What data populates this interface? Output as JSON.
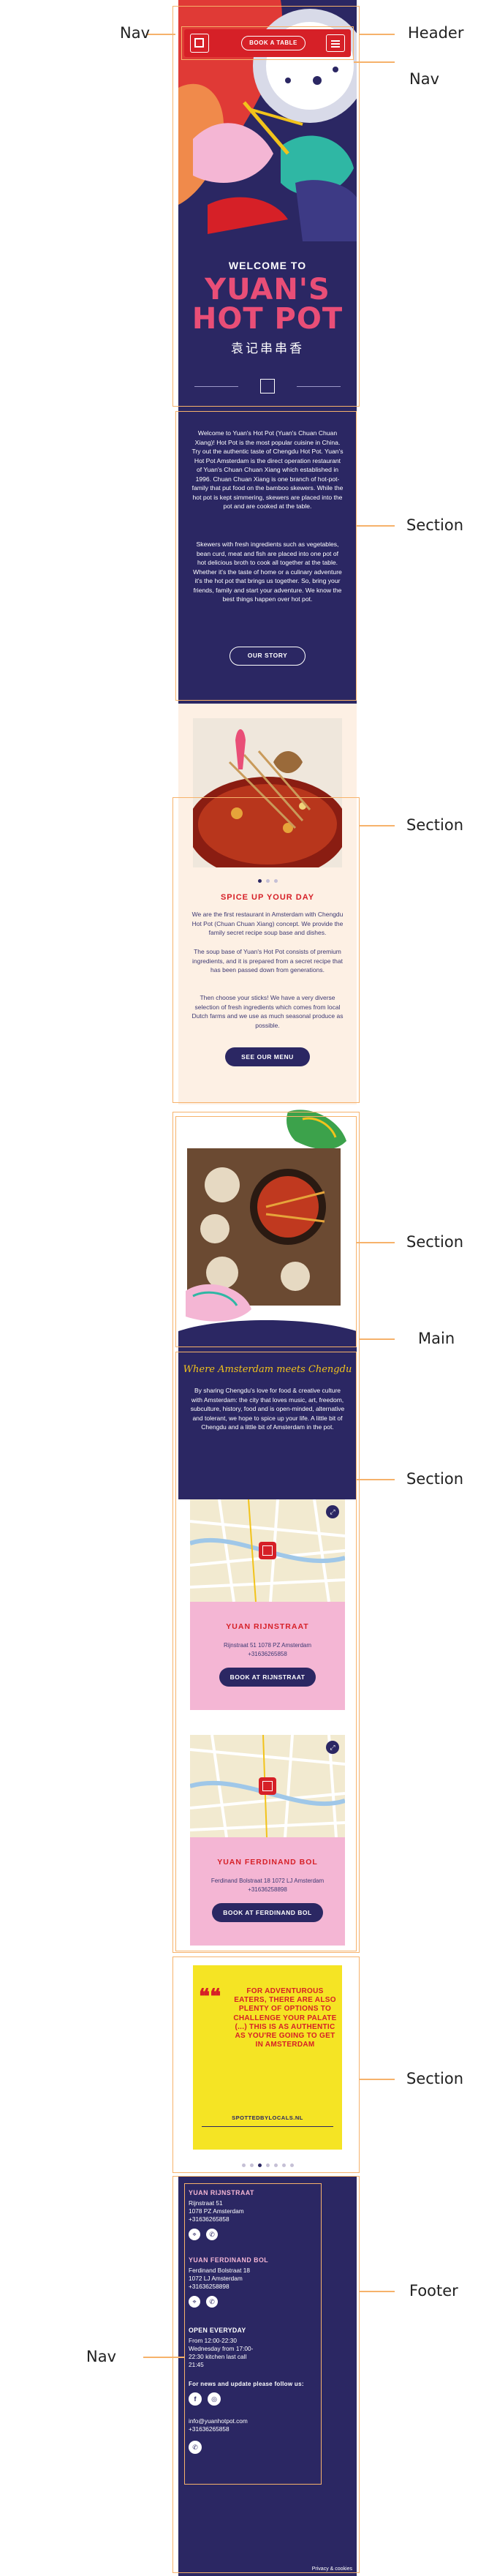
{
  "annotations": {
    "header": "Header",
    "nav_left": "Nav",
    "nav_right": "Nav",
    "section_1": "Section",
    "section_2": "Section",
    "section_3": "Section",
    "main": "Main",
    "section_4": "Section",
    "section_5": "Section",
    "footer": "Footer",
    "nav_footer": "Nav"
  },
  "header": {
    "book_label": "BOOK A TABLE",
    "welcome": "WELCOME TO",
    "brand_line1": "YUAN'S",
    "brand_line2": "HOT POT",
    "chinese_text": "袁记串串香"
  },
  "story": {
    "paragraph1": "Welcome to Yuan's Hot Pot (Yuan's Chuan Chuan Xiang)! Hot Pot is the most popular cuisine in China. Try out the authentic taste of Chengdu Hot Pot. Yuan's Hot Pot Amsterdam is the direct operation restaurant of Yuan's Chuan Chuan Xiang which established in 1996. Chuan Chuan Xiang is one branch of hot-pot-family that put food on the bamboo skewers. While the hot pot is kept simmering, skewers are placed into the pot and are cooked at the table.",
    "paragraph2": "Skewers with fresh ingredients such as vegetables, bean curd, meat and fish are placed into one pot of hot delicious broth to cook all together at the table. Whether it's the taste of home or a culinary adventure it's the hot pot that brings us together. So, bring your friends, family and start your adventure. We know the best things happen over hot pot.",
    "button": "OUR STORY"
  },
  "spice": {
    "title": "SPICE UP YOUR DAY",
    "paragraph1": "We are the first restaurant in Amsterdam with Chengdu Hot Pot (Chuan Chuan Xiang) concept. We provide the family secret recipe soup base and dishes.",
    "paragraph2": "The soup base of Yuan's Hot Pot consists of premium ingredients, and it is prepared from a secret recipe that has been passed down from generations.",
    "paragraph3": "Then choose your sticks! We have a very diverse selection of fresh ingredients which comes from local Dutch farms and we use as much seasonal produce as possible.",
    "button": "SEE OUR MENU"
  },
  "places": {
    "tagline": "Where Amsterdam meets Chengdu",
    "intro": "By sharing Chengdu's love for food & creative culture with Amsterdam: the city that loves music, art, freedom, subculture, history, food and is open-minded, alternative and tolerant, we hope to spice up your life. A little bit of Chengdu and a little bit of Amsterdam in the pot.",
    "locations": [
      {
        "name": "YUAN RIJNSTRAAT",
        "address": "Rijnstraat 51 1078 PZ Amsterdam",
        "phone": "+31636265858",
        "button": "BOOK AT RIJNSTRAAT"
      },
      {
        "name": "YUAN FERDINAND BOL",
        "address": "Ferdinand Bolstraat 18 1072 LJ Amsterdam",
        "phone": "+31636258898",
        "button": "BOOK AT FERDINAND BOL"
      }
    ]
  },
  "testimonial": {
    "quote": "FOR ADVENTUROUS EATERS, THERE ARE ALSO PLENTY OF OPTIONS TO CHALLENGE YOUR PALATE (...) THIS IS AS AUTHENTIC AS YOU'RE GOING TO GET IN AMSTERDAM",
    "source": "SPOTTEDBYLOCALS.NL"
  },
  "footer": {
    "loc1_name": "YUAN RIJNSTRAAT",
    "loc1_street": "Rijnstraat 51",
    "loc1_city": "1078 PZ Amsterdam",
    "loc1_phone": "+31636265858",
    "loc2_name": "YUAN FERDINAND BOL",
    "loc2_street": "Ferdinand Bolstraat 18",
    "loc2_city": "1072 LJ Amsterdam",
    "loc2_phone": "+31636258898",
    "hours_title": "OPEN EVERYDAY",
    "hours_1": "From 12:00-22:30",
    "hours_2": "Wednesday from 17:00-",
    "hours_3": "22:30 kitchen last call",
    "hours_4": "21:45",
    "follow": "For news and update please follow us:",
    "email": "info@yuanhotpot.com",
    "phone": "+31636265858",
    "privacy": "Privacy & cookies"
  },
  "colors": {
    "navy": "#2b2763",
    "red": "#d62027",
    "pink": "#f4b6d4",
    "yellow": "#f5e424",
    "cream": "#fdf0e4",
    "annotation": "#f6b26b"
  }
}
